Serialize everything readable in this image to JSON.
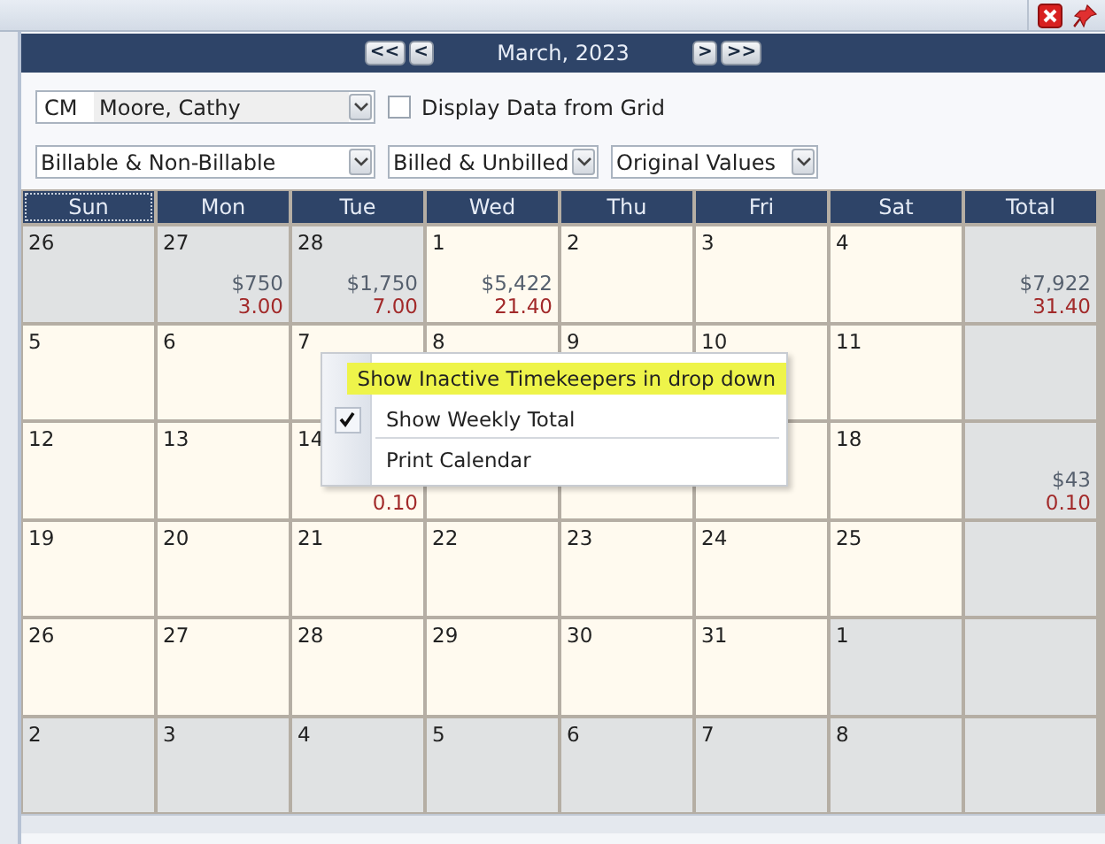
{
  "nav": {
    "buttons": [
      "<<",
      "<",
      ">",
      ">>"
    ],
    "title": "March, 2023"
  },
  "filters": {
    "timekeeper": {
      "code": "CM",
      "name": "Moore, Cathy"
    },
    "display_from_grid": {
      "label": "Display Data from Grid",
      "checked": false
    },
    "dropdowns": [
      "Billable & Non-Billable",
      "Billed & Unbilled",
      "Original Values"
    ]
  },
  "calendar": {
    "columns": [
      {
        "label": "Sun",
        "selected": true
      },
      {
        "label": "Mon",
        "selected": false
      },
      {
        "label": "Tue",
        "selected": false
      },
      {
        "label": "Wed",
        "selected": false
      },
      {
        "label": "Thu",
        "selected": false
      },
      {
        "label": "Fri",
        "selected": false
      },
      {
        "label": "Sat",
        "selected": false
      },
      {
        "label": "Total",
        "selected": false
      }
    ],
    "weeks": [
      {
        "days": [
          {
            "date": "26",
            "in_month": false
          },
          {
            "date": "27",
            "in_month": false,
            "amount": "$750",
            "hours": "3.00"
          },
          {
            "date": "28",
            "in_month": false,
            "amount": "$1,750",
            "hours": "7.00"
          },
          {
            "date": "1",
            "in_month": true,
            "amount": "$5,422",
            "hours": "21.40"
          },
          {
            "date": "2",
            "in_month": true
          },
          {
            "date": "3",
            "in_month": true
          },
          {
            "date": "4",
            "in_month": true
          }
        ],
        "total": {
          "amount": "$7,922",
          "hours": "31.40"
        }
      },
      {
        "days": [
          {
            "date": "5",
            "in_month": true
          },
          {
            "date": "6",
            "in_month": true
          },
          {
            "date": "7",
            "in_month": true
          },
          {
            "date": "8",
            "in_month": true
          },
          {
            "date": "9",
            "in_month": true
          },
          {
            "date": "10",
            "in_month": true
          },
          {
            "date": "11",
            "in_month": true
          }
        ]
      },
      {
        "days": [
          {
            "date": "12",
            "in_month": true
          },
          {
            "date": "13",
            "in_month": true
          },
          {
            "date": "14",
            "in_month": true,
            "hours": "0.10"
          },
          {
            "in_month": true
          },
          {
            "in_month": true
          },
          {
            "in_month": true
          },
          {
            "date": "18",
            "in_month": true
          }
        ],
        "total": {
          "amount": "$43",
          "hours": "0.10"
        }
      },
      {
        "days": [
          {
            "date": "19",
            "in_month": true
          },
          {
            "date": "20",
            "in_month": true
          },
          {
            "date": "21",
            "in_month": true
          },
          {
            "date": "22",
            "in_month": true
          },
          {
            "date": "23",
            "in_month": true
          },
          {
            "date": "24",
            "in_month": true
          },
          {
            "date": "25",
            "in_month": true
          }
        ]
      },
      {
        "days": [
          {
            "date": "26",
            "in_month": true
          },
          {
            "date": "27",
            "in_month": true
          },
          {
            "date": "28",
            "in_month": true
          },
          {
            "date": "29",
            "in_month": true
          },
          {
            "date": "30",
            "in_month": true
          },
          {
            "date": "31",
            "in_month": true
          },
          {
            "date": "1",
            "in_month": false
          }
        ]
      },
      {
        "days": [
          {
            "date": "2",
            "in_month": false
          },
          {
            "date": "3",
            "in_month": false
          },
          {
            "date": "4",
            "in_month": false
          },
          {
            "date": "5",
            "in_month": false
          },
          {
            "date": "6",
            "in_month": false
          },
          {
            "date": "7",
            "in_month": false
          },
          {
            "date": "8",
            "in_month": false
          }
        ]
      }
    ]
  },
  "context_menu": {
    "items": [
      {
        "label": "Show Inactive Timekeepers in drop down",
        "checked": false,
        "selected": true,
        "separator_after": false
      },
      {
        "label": "Show Weekly Total",
        "checked": true,
        "selected": false,
        "separator_after": true
      },
      {
        "label": "Print Calendar",
        "checked": false,
        "selected": false,
        "separator_after": false
      }
    ]
  }
}
